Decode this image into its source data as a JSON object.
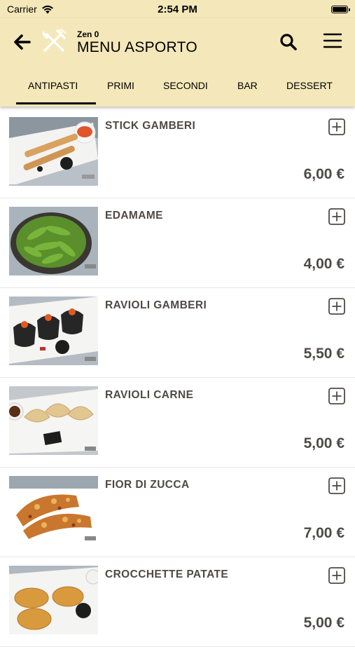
{
  "status_bar": {
    "carrier": "Carrier",
    "time": "2:54 PM"
  },
  "header": {
    "subtitle": "Zen 0",
    "title": "MENU ASPORTO",
    "icons": [
      "back-arrow-icon",
      "cutlery-icon",
      "search-icon",
      "hamburger-menu-icon"
    ],
    "background_color": "#f4e7b9"
  },
  "tabs": [
    {
      "label": "ANTIPASTI",
      "active": true
    },
    {
      "label": "PRIMI",
      "active": false
    },
    {
      "label": "SECONDI",
      "active": false
    },
    {
      "label": "BAR",
      "active": false
    },
    {
      "label": "DESSERT",
      "active": false
    }
  ],
  "items": [
    {
      "name": "STICK GAMBERI",
      "price": "6,00 €",
      "image": "spring-rolls-photo"
    },
    {
      "name": "EDAMAME",
      "price": "4,00 €",
      "image": "edamame-photo"
    },
    {
      "name": "RAVIOLI GAMBERI",
      "price": "5,50 €",
      "image": "shrimp-dumplings-photo"
    },
    {
      "name": "RAVIOLI CARNE",
      "price": "5,00 €",
      "image": "meat-dumplings-photo"
    },
    {
      "name": "FIOR DI ZUCCA",
      "price": "7,00 €",
      "image": "pumpkin-flower-photo"
    },
    {
      "name": "CROCCHETTE PATATE",
      "price": "5,00 €",
      "image": "potato-croquettes-photo"
    }
  ],
  "colors": {
    "text_dark": "#4e4a47",
    "accent": "#000000"
  }
}
